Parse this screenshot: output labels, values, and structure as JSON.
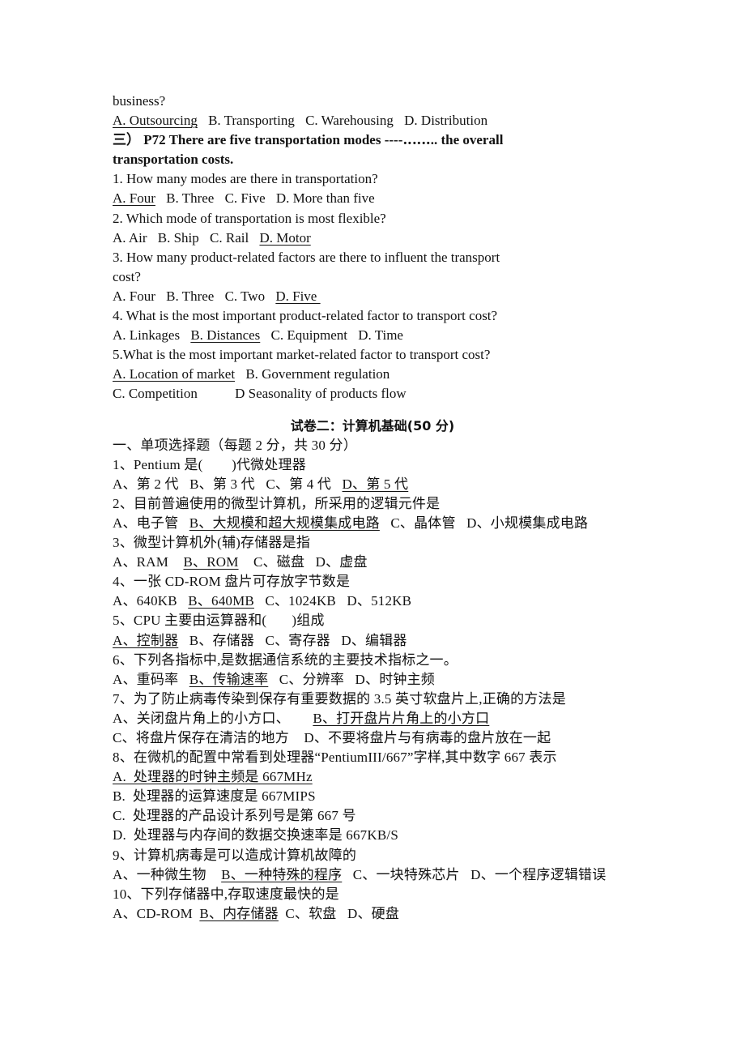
{
  "part1": {
    "prev_question_tail": "business?",
    "prev_options": [
      {
        "text": "A. Outsourcing",
        "correct": true
      },
      {
        "text": "B. Transporting",
        "correct": false
      },
      {
        "text": "C. Warehousing",
        "correct": false
      },
      {
        "text": "D. Distribution",
        "correct": false
      }
    ],
    "section_heading_line1": "三）   P72 There are five transportation modes ----‥‥‥.. the overall",
    "section_heading_line2": "transportation costs.",
    "questions": [
      {
        "q": "1. How many modes are there in transportation?",
        "options": [
          {
            "text": "A. Four",
            "correct": true
          },
          {
            "text": "B. Three",
            "correct": false
          },
          {
            "text": "C. Five",
            "correct": false
          },
          {
            "text": "D. More than five",
            "correct": false
          }
        ]
      },
      {
        "q": "2. Which mode of transportation is most flexible?",
        "options": [
          {
            "text": "A. Air",
            "correct": false
          },
          {
            "text": "B. Ship",
            "correct": false
          },
          {
            "text": "C. Rail",
            "correct": false
          },
          {
            "text": "D. Motor",
            "correct": true
          }
        ]
      },
      {
        "q_line1": "3. How many product-related factors are there to influent the transport",
        "q_line2": "cost?",
        "options": [
          {
            "text": "A. Four",
            "correct": false
          },
          {
            "text": "B. Three",
            "correct": false
          },
          {
            "text": "C. Two",
            "correct": false
          },
          {
            "text": "D. Five ",
            "correct": true
          }
        ]
      },
      {
        "q": "4. What is the most important product-related factor to transport cost?",
        "options": [
          {
            "text": "A. Linkages",
            "correct": false
          },
          {
            "text": "B. Distances",
            "correct": true
          },
          {
            "text": "C. Equipment",
            "correct": false
          },
          {
            "text": "D. Time",
            "correct": false
          }
        ]
      },
      {
        "q": "5.What is the most important market-related factor to transport cost?",
        "options_line1": [
          {
            "text": "A. Location of market",
            "correct": true
          },
          {
            "text": "B. Government regulation",
            "correct": false
          }
        ],
        "options_line2": [
          {
            "text": "C. Competition",
            "correct": false
          },
          {
            "text": "D Seasonality of products flow",
            "correct": false
          }
        ]
      }
    ]
  },
  "part2": {
    "title": "试卷二：计算机基础(50 分)",
    "section": "一、单项选择题（每题 2 分，共 30 分）",
    "questions": [
      {
        "q": "1、Pentium 是(        )代微处理器",
        "options": [
          {
            "text": "A、第 2 代",
            "correct": false
          },
          {
            "text": "B、第 3 代",
            "correct": false
          },
          {
            "text": "C、第 4 代",
            "correct": false
          },
          {
            "text": "D、第 5 代",
            "correct": true
          }
        ]
      },
      {
        "q": "2、目前普遍使用的微型计算机，所采用的逻辑元件是",
        "options": [
          {
            "text": "A、电子管",
            "correct": false
          },
          {
            "text": "B、大规模和超大规模集成电路",
            "correct": true
          },
          {
            "text": "C、晶体管",
            "correct": false
          },
          {
            "text": "D、小规模集成电路",
            "correct": false
          }
        ]
      },
      {
        "q": "3、微型计算机外(辅)存储器是指",
        "options": [
          {
            "text": "A、RAM",
            "correct": false
          },
          {
            "text": "B、ROM",
            "correct": true
          },
          {
            "text": "C、磁盘",
            "correct": false
          },
          {
            "text": "D、虚盘",
            "correct": false
          }
        ]
      },
      {
        "q": "4、一张 CD-ROM 盘片可存放字节数是",
        "options": [
          {
            "text": "A、640KB",
            "correct": false
          },
          {
            "text": "B、640MB",
            "correct": true
          },
          {
            "text": "C、1024KB",
            "correct": false
          },
          {
            "text": "D、512KB",
            "correct": false
          }
        ]
      },
      {
        "q": "5、CPU 主要由运算器和(       )组成",
        "options": [
          {
            "text": "A、控制器",
            "correct": true
          },
          {
            "text": "B、存储器",
            "correct": false
          },
          {
            "text": "C、寄存器",
            "correct": false
          },
          {
            "text": "D、编辑器",
            "correct": false
          }
        ]
      },
      {
        "q": "6、下列各指标中,是数据通信系统的主要技术指标之一。",
        "options": [
          {
            "text": "A、重码率",
            "correct": false
          },
          {
            "text": "B、传输速率",
            "correct": true
          },
          {
            "text": "C、分辨率",
            "correct": false
          },
          {
            "text": "D、时钟主频",
            "correct": false
          }
        ]
      },
      {
        "q": "7、为了防止病毒传染到保存有重要数据的 3.5 英寸软盘片上,正确的方法是",
        "options_line1": [
          {
            "text": "A、关闭盘片角上的小方口、",
            "correct": false
          },
          {
            "text": "B、打开盘片片角上的小方口",
            "correct": true
          }
        ],
        "options_line2": [
          {
            "text": "C、将盘片保存在清洁的地方",
            "correct": false
          },
          {
            "text": "D、不要将盘片与有病毒的盘片放在一起",
            "correct": false
          }
        ]
      },
      {
        "q": "8、在微机的配置中常看到处理器“PentiumIII/667”字样,其中数字 667 表示",
        "options": [
          {
            "text": "A.  处理器的时钟主频是 667MHz",
            "correct": true
          },
          {
            "text": "B.  处理器的运算速度是 667MIPS",
            "correct": false
          },
          {
            "text": "C.  处理器的产品设计系列号是第 667 号",
            "correct": false
          },
          {
            "text": "D.  处理器与内存间的数据交换速率是 667KB/S",
            "correct": false
          }
        ]
      },
      {
        "q": "9、计算机病毒是可以造成计算机故障的",
        "options": [
          {
            "text": "A、一种微生物",
            "correct": false
          },
          {
            "text": "B、一种特殊的程序",
            "correct": true
          },
          {
            "text": "C、一块特殊芯片",
            "correct": false
          },
          {
            "text": "D、一个程序逻辑错误",
            "correct": false
          }
        ]
      },
      {
        "q": "10、下列存储器中,存取速度最快的是",
        "options": [
          {
            "text": "A、CD-ROM",
            "correct": false
          },
          {
            "text": "B、内存储器",
            "correct": true
          },
          {
            "text": "C、软盘",
            "correct": false
          },
          {
            "text": "D、硬盘",
            "correct": false
          }
        ]
      }
    ]
  }
}
